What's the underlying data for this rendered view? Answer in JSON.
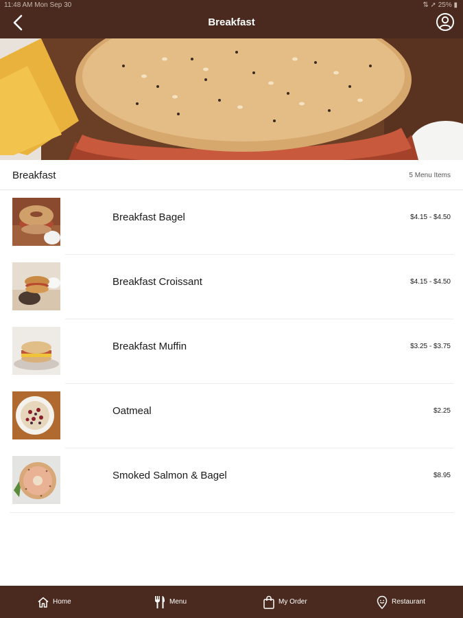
{
  "status_bar": {
    "time": "11:48 AM   Mon Sep 30",
    "indicators": "⇅ ➚ 25% ▮"
  },
  "header": {
    "title": "Breakfast"
  },
  "section": {
    "title": "Breakfast",
    "count": "5 Menu Items"
  },
  "menu": {
    "items": [
      {
        "name": "Breakfast Bagel",
        "price": "$4.15 - $4.50"
      },
      {
        "name": "Breakfast Croissant",
        "price": "$4.15 - $4.50"
      },
      {
        "name": "Breakfast Muffin",
        "price": "$3.25 - $3.75"
      },
      {
        "name": "Oatmeal",
        "price": "$2.25"
      },
      {
        "name": "Smoked Salmon & Bagel",
        "price": "$8.95"
      }
    ]
  },
  "tabbar": {
    "home": "Home",
    "menu": "Menu",
    "order": "My Order",
    "restaurant": "Restaurant"
  },
  "colors": {
    "brand_brown": "#4a2a1e"
  }
}
